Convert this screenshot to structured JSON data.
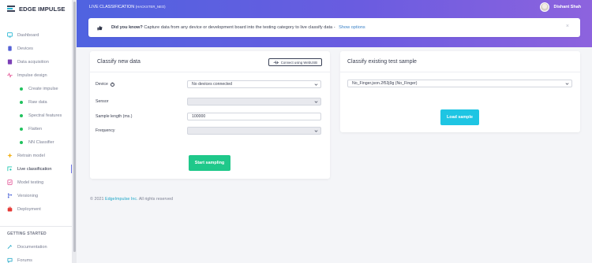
{
  "brand": {
    "name": "EDGE IMPULSE"
  },
  "header": {
    "title": "LIVE CLASSIFICATION",
    "project": "(HACKSTER_NEO)",
    "user_name": "Dishant Shah"
  },
  "sidebar": {
    "items": [
      {
        "label": "Dashboard",
        "icon": "monitor-icon"
      },
      {
        "label": "Devices",
        "icon": "devices-icon"
      },
      {
        "label": "Data acquisition",
        "icon": "database-icon"
      },
      {
        "label": "Impulse design",
        "icon": "pulse-icon"
      },
      {
        "label": "Create impulse",
        "icon": "green-dot-icon"
      },
      {
        "label": "Raw data",
        "icon": "green-dot-icon"
      },
      {
        "label": "Spectral features",
        "icon": "green-dot-icon"
      },
      {
        "label": "Flatten",
        "icon": "green-dot-icon"
      },
      {
        "label": "NN Classifier",
        "icon": "green-dot-icon"
      },
      {
        "label": "Retrain model",
        "icon": "retrain-icon"
      },
      {
        "label": "Live classification",
        "icon": "live-icon"
      },
      {
        "label": "Model testing",
        "icon": "testing-icon"
      },
      {
        "label": "Versioning",
        "icon": "versioning-icon"
      },
      {
        "label": "Deployment",
        "icon": "deployment-icon"
      }
    ],
    "section_title": "GETTING STARTED",
    "getting_started": [
      {
        "label": "Documentation",
        "icon": "doc-icon"
      },
      {
        "label": "Forums",
        "icon": "forums-icon"
      }
    ]
  },
  "notice": {
    "bold": "Did you know?",
    "text": "Capture data from any device or development board into the testing category to live classify data -",
    "link": "Show options",
    "close": "×"
  },
  "classify_new": {
    "title": "Classify new data",
    "webusb_label": "Connect using WebUSB",
    "fields": [
      {
        "label": "Device",
        "value": "No devices connected"
      },
      {
        "label": "Sensor",
        "value": ""
      },
      {
        "label": "Sample length (ms.)",
        "value": "100000"
      },
      {
        "label": "Frequency",
        "value": ""
      }
    ],
    "start_button": "Start sampling"
  },
  "classify_existing": {
    "title": "Classify existing test sample",
    "selected": "No_Finger.json.2f53j9g (No_Finger)",
    "load_button": "Load sample"
  },
  "footer": {
    "prefix": "© 2021",
    "company": "EdgeImpulse Inc.",
    "suffix": "All rights reserved"
  },
  "colors": {
    "accent": "#6f77e5",
    "green": "#1fc88a",
    "blue": "#1ec5e3",
    "link": "#3b82c7"
  }
}
